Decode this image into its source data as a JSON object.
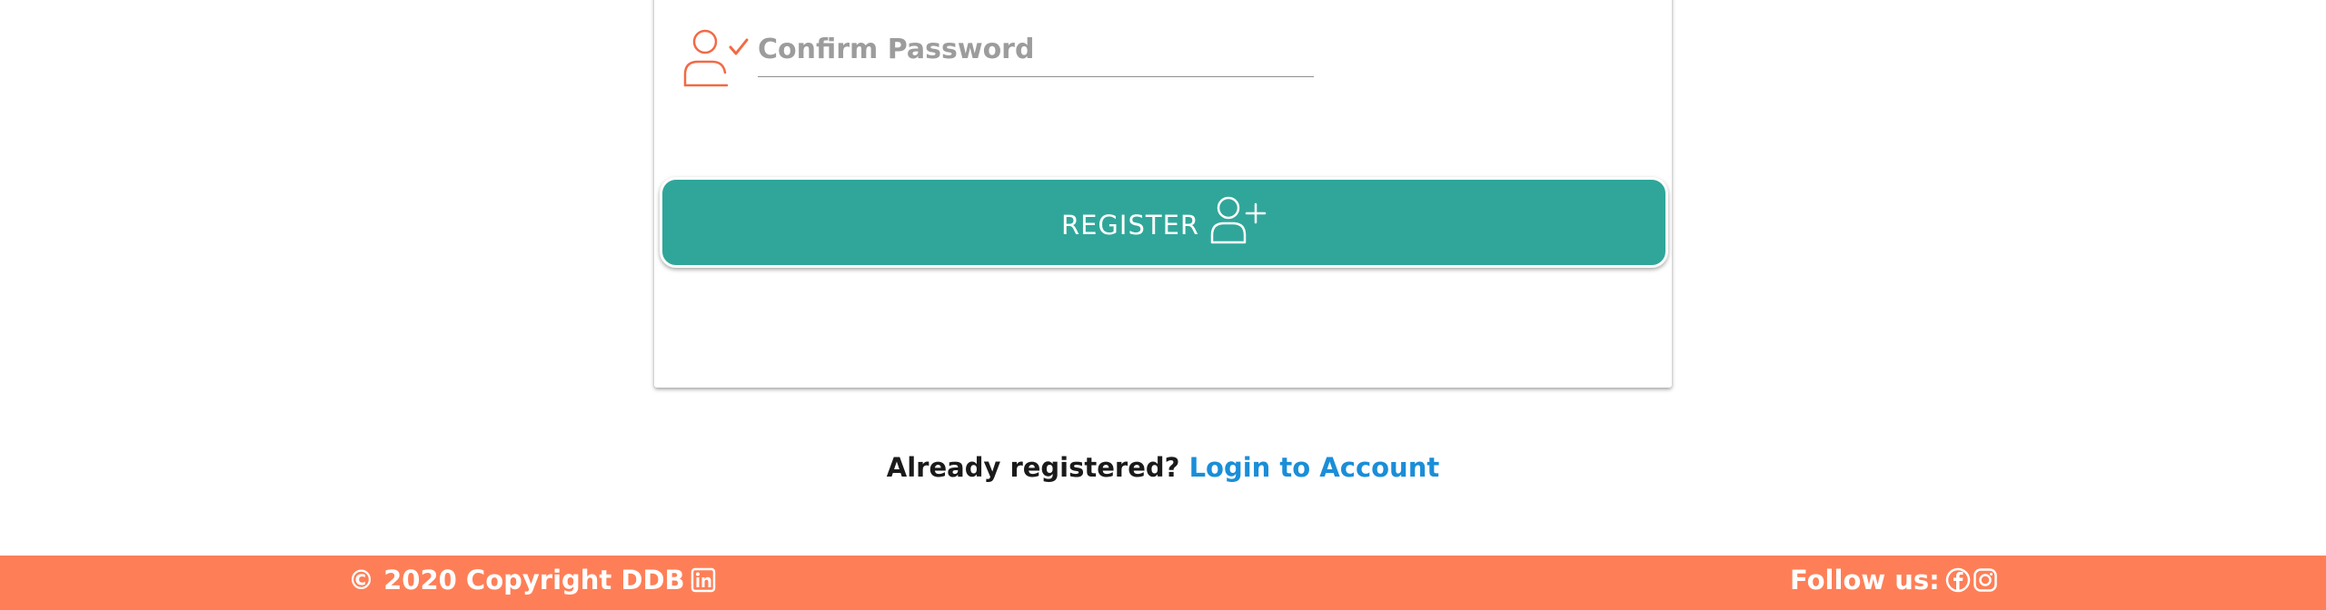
{
  "form": {
    "confirm_password": {
      "placeholder": "Confirm Password",
      "value": "",
      "icon": "user-check-icon"
    },
    "register_button": {
      "label": "REGISTER",
      "icon": "user-plus-icon"
    }
  },
  "login_prompt": {
    "text": "Already registered?",
    "link_label": "Login to Account"
  },
  "footer": {
    "copyright": "© 2020 Copyright DDB",
    "copyright_icon": "linkedin-icon",
    "follow_label": "Follow us:",
    "social_icons": [
      "facebook-icon",
      "instagram-icon"
    ]
  },
  "colors": {
    "accent_teal": "#30a69a",
    "footer_orange": "#fe7f57",
    "icon_orange": "#f26a45",
    "link_blue": "#1a8ed8"
  }
}
